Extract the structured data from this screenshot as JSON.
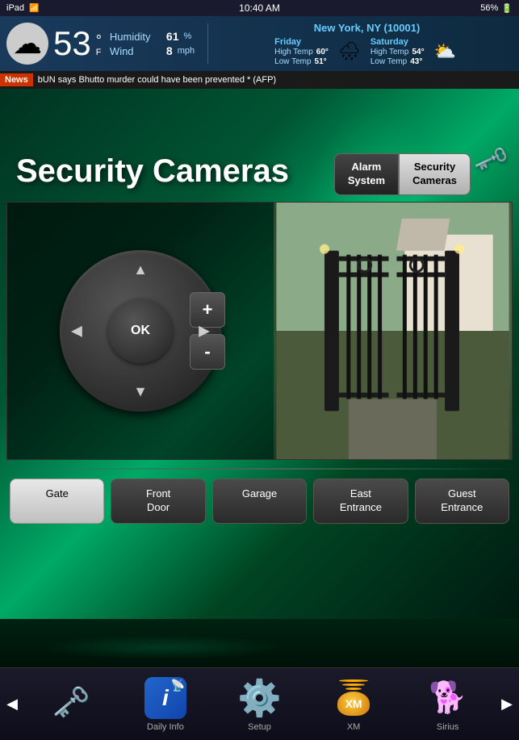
{
  "statusBar": {
    "device": "iPad",
    "wifi": "wifi",
    "time": "10:40 AM",
    "battery": "56%"
  },
  "weather": {
    "cloudIcon": "☁",
    "temp": "53",
    "tempUnit": "°",
    "tempScale": "F",
    "humidity_label": "Humidity",
    "humidity_value": "61",
    "humidity_unit": "%",
    "wind_label": "Wind",
    "wind_value": "8",
    "wind_unit": "mph",
    "location": "New York, NY (10001)",
    "friday": {
      "label": "Friday",
      "highLabel": "High Temp",
      "highVal": "60°",
      "lowLabel": "Low Temp",
      "lowVal": "51°",
      "icon": "🌧"
    },
    "saturday": {
      "label": "Saturday",
      "highLabel": "High Temp",
      "highVal": "54°",
      "lowLabel": "Low Temp",
      "lowVal": "43°",
      "icon": "⛅"
    }
  },
  "news": {
    "label": "News",
    "text": "bUN says Bhutto murder could have been prevented * (AFP)"
  },
  "main": {
    "title": "Security Cameras",
    "tabs": [
      {
        "id": "alarm",
        "label": "Alarm\nSystem",
        "active": false
      },
      {
        "id": "cameras",
        "label": "Security\nCameras",
        "active": true
      }
    ],
    "cameras": [
      {
        "id": "gate",
        "label": "Gate",
        "active": true
      },
      {
        "id": "front-door",
        "label": "Front\nDoor",
        "active": false
      },
      {
        "id": "garage",
        "label": "Garage",
        "active": false
      },
      {
        "id": "east-entrance",
        "label": "East\nEntrance",
        "active": false
      },
      {
        "id": "guest-entrance",
        "label": "Guest\nEntrance",
        "active": false
      }
    ],
    "dpad": {
      "ok": "OK",
      "plus": "+",
      "minus": "-"
    }
  },
  "bottomNav": {
    "leftArrow": "◀",
    "rightArrow": "▶",
    "items": [
      {
        "id": "keys",
        "label": "",
        "icon": "keys"
      },
      {
        "id": "daily-info",
        "label": "Daily Info",
        "icon": "info"
      },
      {
        "id": "setup",
        "label": "Setup",
        "icon": "gear"
      },
      {
        "id": "xm",
        "label": "XM",
        "icon": "xm"
      },
      {
        "id": "sirius",
        "label": "Sirius",
        "icon": "sirius"
      }
    ]
  }
}
